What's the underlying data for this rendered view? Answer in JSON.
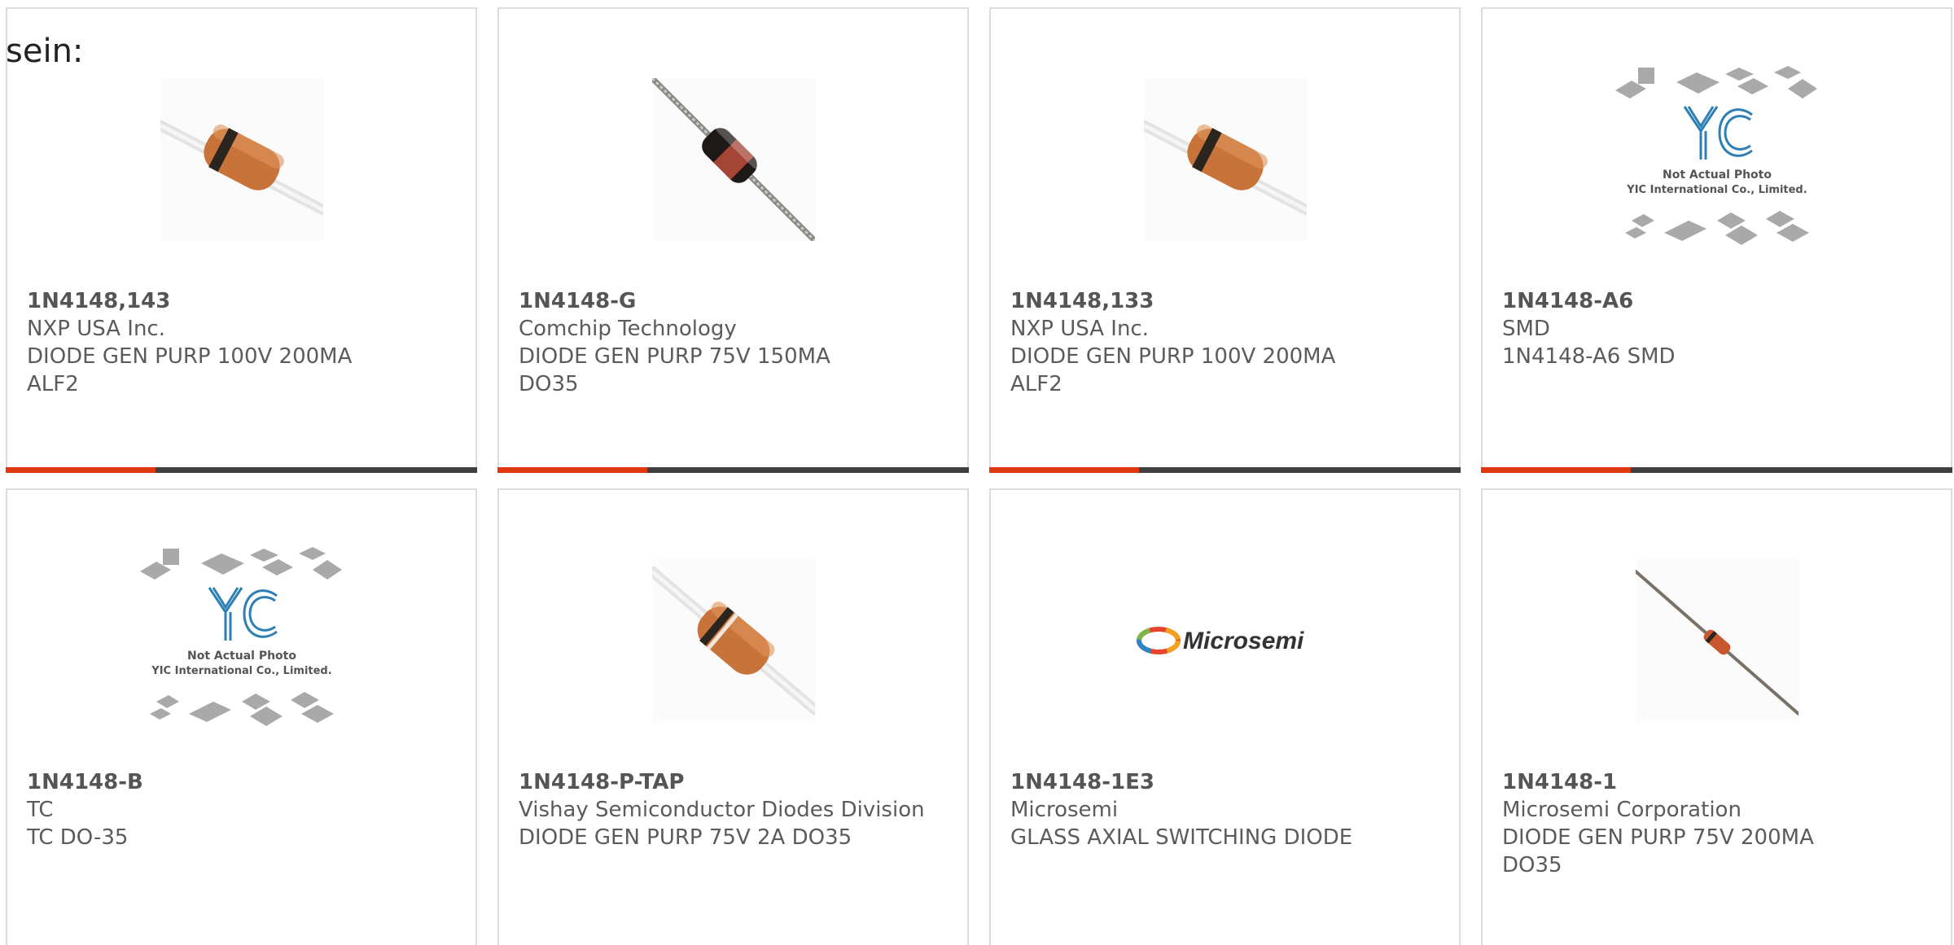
{
  "lead_text": "sein:",
  "colors": {
    "accent": "#e0370e",
    "bar_dark": "#3f3f3f",
    "card_border": "#dcdcdc",
    "text": "#5b5b5b"
  },
  "products": [
    {
      "part_number": "1N4148,143",
      "manufacturer": "NXP USA Inc.",
      "desc_1": "DIODE GEN PURP 100V 200MA",
      "desc_2": "ALF2",
      "image": "axial-diode-orange-photo"
    },
    {
      "part_number": "1N4148-G",
      "manufacturer": "Comchip Technology",
      "desc_1": "DIODE GEN PURP 75V 150MA",
      "desc_2": "DO35",
      "image": "axial-diode-glass-photo"
    },
    {
      "part_number": "1N4148,133",
      "manufacturer": "NXP USA Inc.",
      "desc_1": "DIODE GEN PURP 100V 200MA",
      "desc_2": "ALF2",
      "image": "axial-diode-orange-photo"
    },
    {
      "part_number": "1N4148-A6",
      "manufacturer": "SMD",
      "desc_1": "1N4148-A6 SMD",
      "desc_2": "",
      "image": "yic-placeholder",
      "placeholder_line_1": "Not Actual Photo",
      "placeholder_line_2": "YIC International Co., Limited."
    },
    {
      "part_number": "1N4148-B",
      "manufacturer": "TC",
      "desc_1": "TC DO-35",
      "desc_2": "",
      "image": "yic-placeholder",
      "placeholder_line_1": "Not Actual Photo",
      "placeholder_line_2": "YIC International Co., Limited."
    },
    {
      "part_number": "1N4148-P-TAP",
      "manufacturer": "Vishay Semiconductor Diodes Division",
      "desc_1": "DIODE GEN PURP 75V 2A DO35",
      "desc_2": "",
      "image": "axial-diode-orange-photo"
    },
    {
      "part_number": "1N4148-1E3",
      "manufacturer": "Microsemi",
      "desc_1": "GLASS AXIAL SWITCHING DIODE",
      "desc_2": "",
      "image": "microsemi-logo",
      "logo_text": "Microsemi"
    },
    {
      "part_number": "1N4148-1",
      "manufacturer": "Microsemi Corporation",
      "desc_1": "DIODE GEN PURP 75V 200MA",
      "desc_2": "DO35",
      "image": "axial-diode-small-photo"
    }
  ]
}
